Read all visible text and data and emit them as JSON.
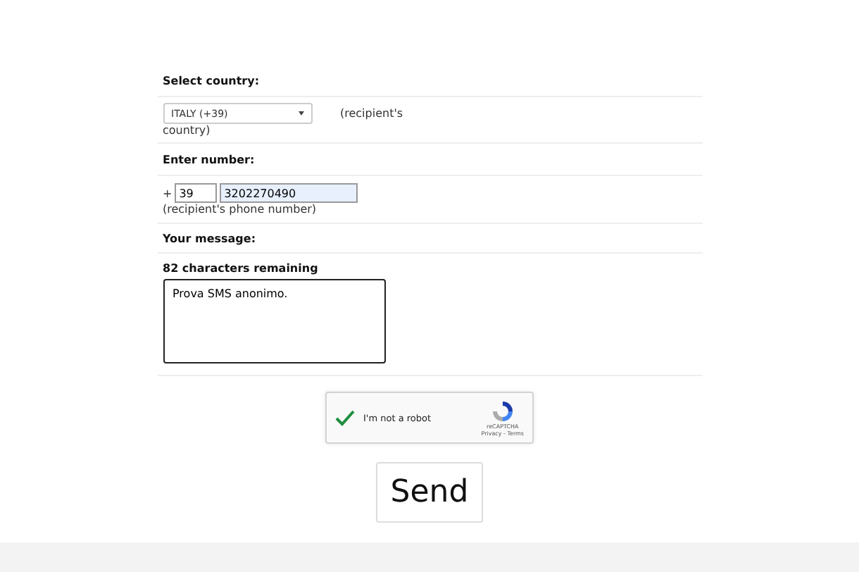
{
  "country": {
    "label": "Select country:",
    "value": "ITALY (+39)",
    "hint_line1": "(recipient's",
    "hint_line2": "country)"
  },
  "number": {
    "label": "Enter number:",
    "prefix": "+",
    "code": "39",
    "value": "3202270490",
    "hint": "(recipient's phone number)"
  },
  "message": {
    "label": "Your message:",
    "remaining": "82 characters remaining",
    "value": "Prova SMS anonimo."
  },
  "captcha": {
    "label": "I'm not a robot",
    "checked": true,
    "brand": "reCAPTCHA",
    "links": "Privacy - Terms"
  },
  "send": "Send"
}
